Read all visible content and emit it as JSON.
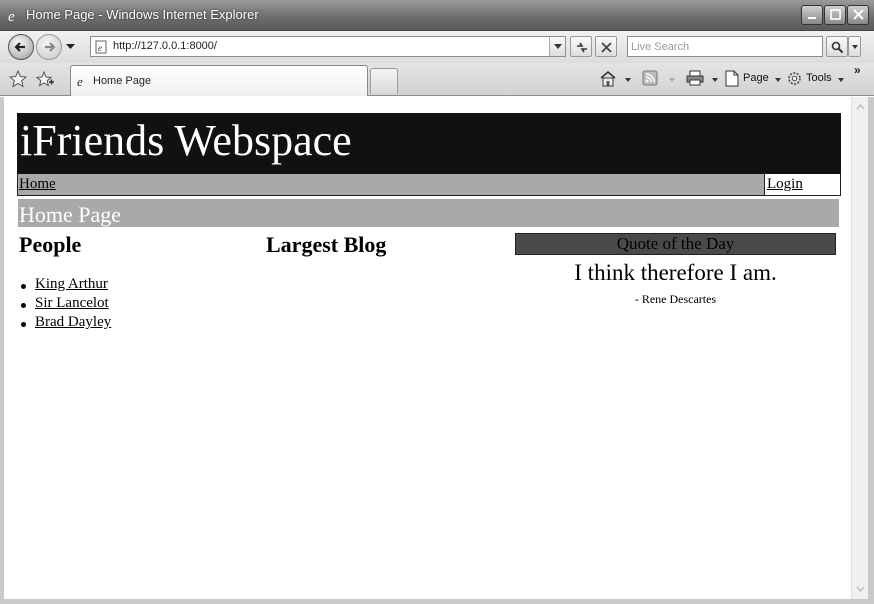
{
  "window": {
    "title": "Home Page - Windows Internet Explorer"
  },
  "toolbar": {
    "url": "http://127.0.0.1:8000/",
    "search_placeholder": "Live Search",
    "tab_label": "Home Page",
    "page_label": "Page",
    "tools_label": "Tools",
    "more_label": "»"
  },
  "site": {
    "title": "iFriends Webspace",
    "nav_home": "Home",
    "nav_login": "Login",
    "page_heading": "Home Page"
  },
  "people": {
    "heading": "People",
    "items": [
      "King Arthur",
      "Sir Lancelot",
      "Brad Dayley"
    ]
  },
  "blog": {
    "heading": "Largest Blog"
  },
  "quote": {
    "heading": "Quote of the Day",
    "text": "I think therefore I am.",
    "author": "- Rene Descartes"
  },
  "colors": {
    "banner": "#111111",
    "nav_bar": "#a9a9a9",
    "quote_header": "#4a4a4a"
  }
}
